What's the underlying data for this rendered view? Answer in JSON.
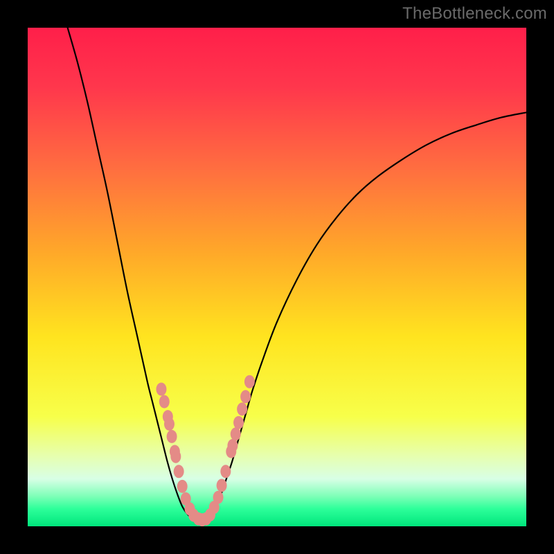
{
  "watermark": "TheBottleneck.com",
  "colors": {
    "frame": "#000000",
    "marker_fill": "#e48b87",
    "marker_stroke": "#b86a66",
    "curve": "#000000",
    "gradient_stops": [
      {
        "offset": 0.0,
        "color": "#ff1f4a"
      },
      {
        "offset": 0.12,
        "color": "#ff374c"
      },
      {
        "offset": 0.28,
        "color": "#ff6d40"
      },
      {
        "offset": 0.45,
        "color": "#ffa829"
      },
      {
        "offset": 0.62,
        "color": "#ffe41f"
      },
      {
        "offset": 0.78,
        "color": "#f7ff4a"
      },
      {
        "offset": 0.86,
        "color": "#e6ffb0"
      },
      {
        "offset": 0.905,
        "color": "#d8ffe6"
      },
      {
        "offset": 0.94,
        "color": "#7dffb7"
      },
      {
        "offset": 0.965,
        "color": "#2dff9a"
      },
      {
        "offset": 1.0,
        "color": "#00e57c"
      }
    ]
  },
  "chart_data": {
    "type": "line",
    "title": "",
    "xlabel": "",
    "ylabel": "",
    "xlim": [
      0,
      100
    ],
    "ylim": [
      0,
      100
    ],
    "curve": [
      {
        "x": 8.0,
        "y": 100.0
      },
      {
        "x": 10.0,
        "y": 93.0
      },
      {
        "x": 12.0,
        "y": 85.0
      },
      {
        "x": 14.0,
        "y": 76.0
      },
      {
        "x": 16.0,
        "y": 67.0
      },
      {
        "x": 18.0,
        "y": 57.0
      },
      {
        "x": 20.0,
        "y": 47.0
      },
      {
        "x": 22.0,
        "y": 38.0
      },
      {
        "x": 24.0,
        "y": 29.0
      },
      {
        "x": 25.0,
        "y": 25.0
      },
      {
        "x": 26.0,
        "y": 21.0
      },
      {
        "x": 27.0,
        "y": 17.0
      },
      {
        "x": 28.0,
        "y": 13.0
      },
      {
        "x": 29.0,
        "y": 9.5
      },
      {
        "x": 30.0,
        "y": 6.5
      },
      {
        "x": 31.0,
        "y": 4.0
      },
      {
        "x": 32.0,
        "y": 2.5
      },
      {
        "x": 33.0,
        "y": 1.5
      },
      {
        "x": 34.0,
        "y": 1.0
      },
      {
        "x": 35.0,
        "y": 1.0
      },
      {
        "x": 36.0,
        "y": 1.5
      },
      {
        "x": 37.0,
        "y": 2.5
      },
      {
        "x": 38.0,
        "y": 4.5
      },
      {
        "x": 39.0,
        "y": 7.0
      },
      {
        "x": 40.0,
        "y": 10.0
      },
      {
        "x": 41.0,
        "y": 13.0
      },
      {
        "x": 42.0,
        "y": 16.5
      },
      {
        "x": 43.0,
        "y": 20.0
      },
      {
        "x": 44.0,
        "y": 23.5
      },
      {
        "x": 45.0,
        "y": 27.0
      },
      {
        "x": 47.0,
        "y": 33.0
      },
      {
        "x": 50.0,
        "y": 41.0
      },
      {
        "x": 54.0,
        "y": 49.5
      },
      {
        "x": 58.0,
        "y": 56.5
      },
      {
        "x": 62.0,
        "y": 62.0
      },
      {
        "x": 66.0,
        "y": 66.5
      },
      {
        "x": 70.0,
        "y": 70.0
      },
      {
        "x": 75.0,
        "y": 73.5
      },
      {
        "x": 80.0,
        "y": 76.5
      },
      {
        "x": 85.0,
        "y": 78.8
      },
      {
        "x": 90.0,
        "y": 80.5
      },
      {
        "x": 95.0,
        "y": 82.0
      },
      {
        "x": 100.0,
        "y": 83.0
      }
    ],
    "markers": [
      {
        "x": 26.8,
        "y": 27.5
      },
      {
        "x": 27.4,
        "y": 25.0
      },
      {
        "x": 28.1,
        "y": 22.0
      },
      {
        "x": 28.4,
        "y": 20.5
      },
      {
        "x": 28.9,
        "y": 18.0
      },
      {
        "x": 29.5,
        "y": 15.0
      },
      {
        "x": 29.7,
        "y": 14.0
      },
      {
        "x": 30.3,
        "y": 11.0
      },
      {
        "x": 31.0,
        "y": 8.0
      },
      {
        "x": 31.7,
        "y": 5.5
      },
      {
        "x": 32.5,
        "y": 3.5
      },
      {
        "x": 33.3,
        "y": 2.2
      },
      {
        "x": 34.2,
        "y": 1.5
      },
      {
        "x": 35.0,
        "y": 1.3
      },
      {
        "x": 35.8,
        "y": 1.5
      },
      {
        "x": 36.6,
        "y": 2.3
      },
      {
        "x": 37.4,
        "y": 3.8
      },
      {
        "x": 38.2,
        "y": 5.8
      },
      {
        "x": 38.9,
        "y": 8.2
      },
      {
        "x": 39.7,
        "y": 11.0
      },
      {
        "x": 40.8,
        "y": 15.0
      },
      {
        "x": 41.1,
        "y": 16.2
      },
      {
        "x": 41.7,
        "y": 18.5
      },
      {
        "x": 42.3,
        "y": 20.8
      },
      {
        "x": 43.0,
        "y": 23.5
      },
      {
        "x": 43.7,
        "y": 26.0
      },
      {
        "x": 44.5,
        "y": 29.0
      }
    ]
  }
}
